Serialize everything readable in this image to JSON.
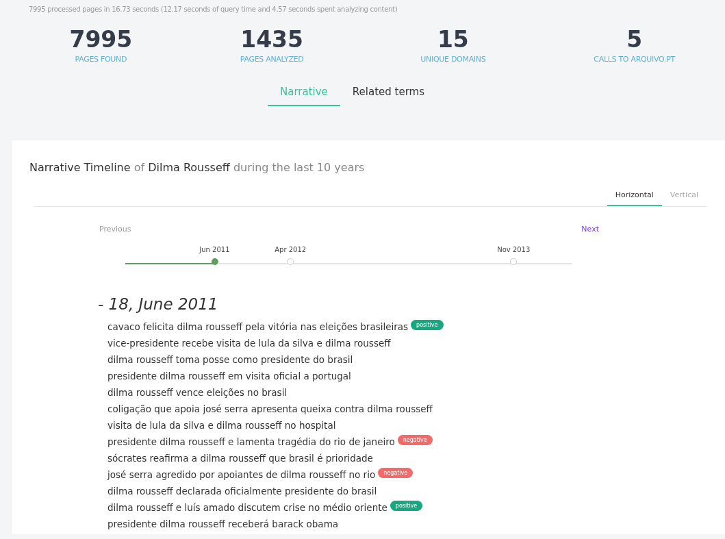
{
  "summary": "7995 processed pages in 16.73 seconds (12.17 seconds of query time and 4.57 seconds spent analyzing content)",
  "stats": [
    {
      "value": "7995",
      "label": "PAGES FOUND"
    },
    {
      "value": "1435",
      "label": "PAGES ANALYZED"
    },
    {
      "value": "15",
      "label": "UNIQUE DOMAINS"
    },
    {
      "value": "5",
      "label": "CALLS TO ARQUIVO.PT"
    }
  ],
  "tabs": [
    {
      "label": "Narrative",
      "selected": true
    },
    {
      "label": "Related terms",
      "selected": false
    }
  ],
  "heading": [
    {
      "text": "Narrative Timeline",
      "strong": true
    },
    {
      "text": "of",
      "strong": false
    },
    {
      "text": "Dilma Rousseff",
      "strong": true
    },
    {
      "text": "during the last 10 years",
      "strong": false
    }
  ],
  "view_tabs": [
    {
      "label": "Horizontal",
      "selected": true
    },
    {
      "label": "Vertical",
      "selected": false
    }
  ],
  "timeline": {
    "previous": "Previous",
    "next": "Next",
    "level": 0.2,
    "points": [
      {
        "label": "Jun 2011",
        "selected": true
      },
      {
        "label": "Apr 2012",
        "selected": false
      },
      {
        "label": "Nov 2013",
        "selected": false
      }
    ]
  },
  "date_heading": "- 18, June 2011",
  "headlines": [
    {
      "text": "cavaco felicita dilma rousseff pela vitória nas eleições brasileiras",
      "sentiment": "positive"
    },
    {
      "text": "vice-presidente recebe visita de lula da silva e dilma rousseff"
    },
    {
      "text": "dilma rousseff toma posse como presidente do brasil"
    },
    {
      "text": "presidente dilma rousseff em visita oficial a portugal"
    },
    {
      "text": "dilma rousseff vence eleições no brasil"
    },
    {
      "text": "coligação que apoia josé serra apresenta queixa contra dilma rousseff"
    },
    {
      "text": "visita de lula da silva e dilma rousseff no hospital"
    },
    {
      "text": "presidente dilma rousseff e lamenta tragédia do rio de janeiro",
      "sentiment": "negative"
    },
    {
      "text": "sócrates reafirma a dilma rousseff que brasil é prioridade"
    },
    {
      "text": "josé serra agredido por apoiantes de dilma rousseff no rio",
      "sentiment": "negative"
    },
    {
      "text": "dilma rousseff declarada oficialmente presidente do brasil"
    },
    {
      "text": "dilma rousseff e luís amado discutem crise no médio oriente",
      "sentiment": "positive"
    },
    {
      "text": "presidente dilma rousseff receberá barack obama"
    }
  ]
}
